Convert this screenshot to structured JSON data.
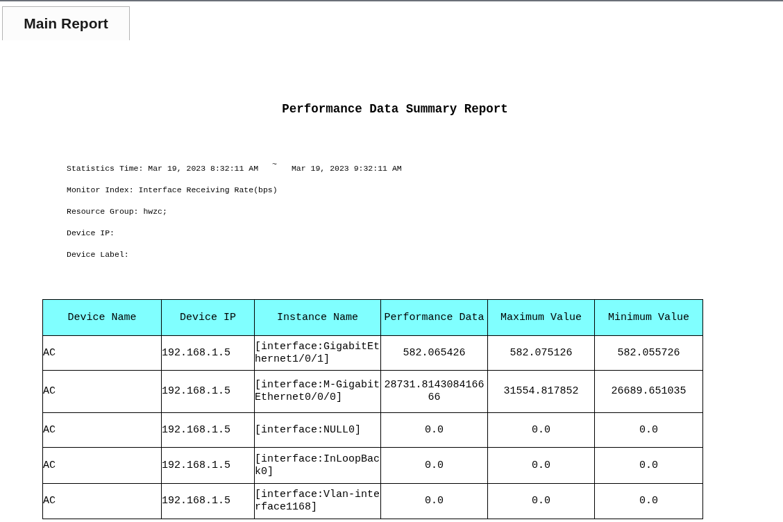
{
  "tabs": [
    {
      "label": "Main Report",
      "selected": true
    }
  ],
  "report": {
    "title": "Performance Data Summary Report",
    "details": [
      {
        "text": "Statistics Time: Mar 19, 2023 8:32:11 AM",
        "separator": "~",
        "text_end": "Mar 19, 2023 9:32:11 AM"
      },
      {
        "text": "Monitor Index: Interface Receiving Rate(bps)"
      },
      {
        "text": "Resource Group: hwzc;"
      },
      {
        "text": "Device IP:"
      },
      {
        "text": "Device Label:"
      }
    ],
    "table": {
      "columns": [
        "Device Name",
        "Device IP",
        "Instance Name",
        "Performance Data",
        "Maximum Value",
        "Minimum Value"
      ],
      "rows": [
        [
          "AC",
          "192.168.1.5",
          "[interface:GigabitEthernet1/0/1]",
          "582.065426",
          "582.075126",
          "582.055726"
        ],
        [
          "AC",
          "192.168.1.5",
          "[interface:M-GigabitEthernet0/0/0]",
          "28731.814308416666",
          "31554.817852",
          "26689.651035"
        ],
        [
          "AC",
          "192.168.1.5",
          "[interface:NULL0]",
          "0.0",
          "0.0",
          "0.0"
        ],
        [
          "AC",
          "192.168.1.5",
          "[interface:InLoopBack0]",
          "0.0",
          "0.0",
          "0.0"
        ],
        [
          "AC",
          "192.168.1.5",
          "[interface:Vlan-interface1168]",
          "0.0",
          "0.0",
          "0.0"
        ]
      ]
    }
  }
}
